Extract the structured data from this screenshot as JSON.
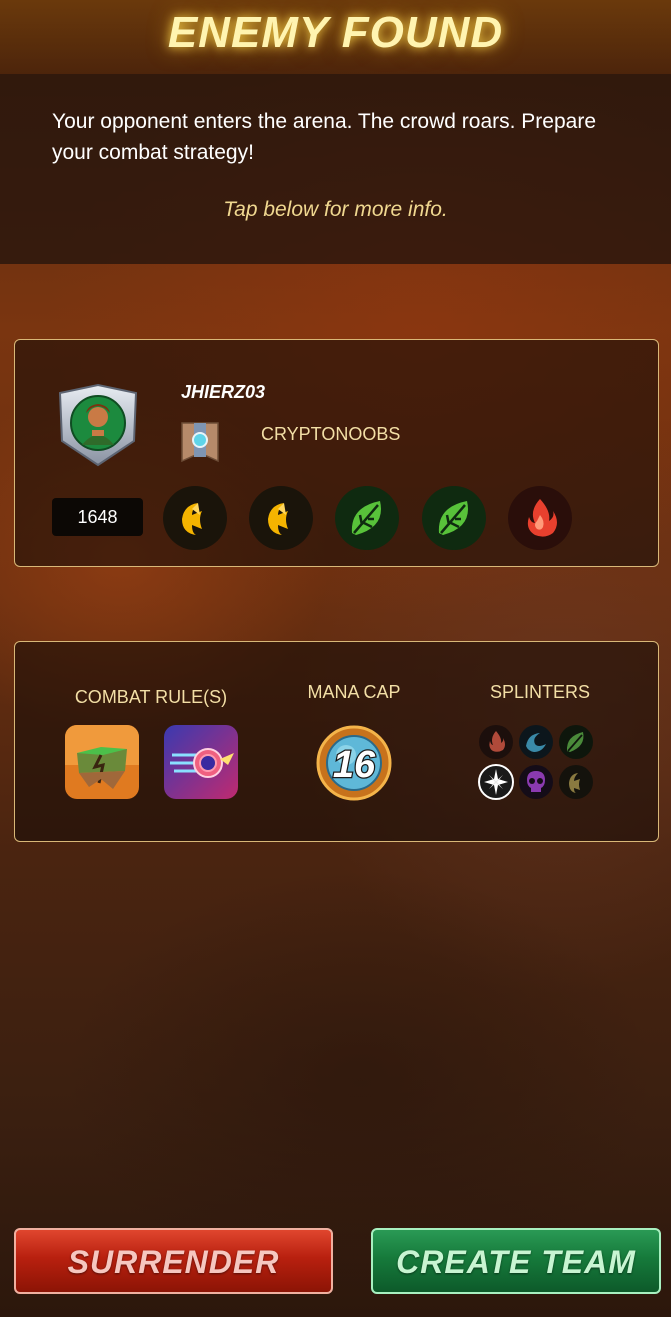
{
  "header": {
    "title": "ENEMY FOUND"
  },
  "intro": {
    "message": "Your opponent enters the arena. The crowd roars. Prepare your combat strategy!",
    "tap_info": "Tap below for more info."
  },
  "opponent": {
    "name": "JHIERZ03",
    "guild": "CRYPTONOOBS",
    "rating": "1648",
    "avatar_icon": "hero-portrait-icon",
    "guild_icon": "guild-banner-icon",
    "recent_splinters": [
      {
        "icon": "death-splinter-icon",
        "color": "#f5b400"
      },
      {
        "icon": "death-splinter-icon",
        "color": "#f5b400"
      },
      {
        "icon": "earth-splinter-icon",
        "color": "#58c23a"
      },
      {
        "icon": "earth-splinter-icon",
        "color": "#58c23a"
      },
      {
        "icon": "fire-splinter-icon",
        "color": "#e8402e"
      }
    ]
  },
  "battle": {
    "combat_rules_label": "COMBAT RULE(S)",
    "mana_cap_label": "MANA CAP",
    "splinters_label": "SPLINTERS",
    "mana_cap": "16",
    "rules": [
      {
        "icon": "earthquake-rule-icon"
      },
      {
        "icon": "super-sneak-rule-icon"
      }
    ],
    "splinters": [
      {
        "icon": "fire-splinter-icon",
        "active": false
      },
      {
        "icon": "water-splinter-icon",
        "active": false
      },
      {
        "icon": "earth-splinter-icon",
        "active": false
      },
      {
        "icon": "life-splinter-icon",
        "active": true
      },
      {
        "icon": "death-splinter-icon",
        "active": false
      },
      {
        "icon": "dragon-splinter-icon",
        "active": false
      }
    ]
  },
  "actions": {
    "surrender_label": "SURRENDER",
    "create_team_label": "CREATE TEAM"
  },
  "colors": {
    "title_glow": "#fff4b0",
    "panel_border": "#d9b878",
    "surrender": "#c0291a",
    "create_team": "#1a7d3f"
  }
}
